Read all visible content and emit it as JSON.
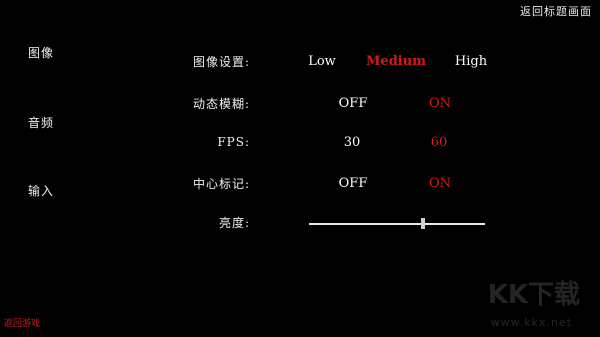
{
  "header": {
    "return_title_label": "返回标题画面"
  },
  "sidebar": {
    "items": [
      {
        "label": "图像"
      },
      {
        "label": "音频"
      },
      {
        "label": "输入"
      }
    ]
  },
  "settings": {
    "image_quality": {
      "label": "图像设置:",
      "options": [
        "Low",
        "Medium",
        "High"
      ],
      "selected": "Medium"
    },
    "motion_blur": {
      "label": "动态模糊:",
      "options": [
        "OFF",
        "ON"
      ],
      "selected": "ON"
    },
    "fps": {
      "label": "FPS:",
      "options": [
        "30",
        "60"
      ],
      "selected": "60"
    },
    "center_marker": {
      "label": "中心标记:",
      "options": [
        "OFF",
        "ON"
      ],
      "selected": "ON"
    },
    "brightness": {
      "label": "亮度:",
      "value": 0.65
    }
  },
  "footer": {
    "return_game_label": "返回游戏"
  },
  "watermark": {
    "text": "KK下载",
    "url": "www.kkx.net"
  },
  "colors": {
    "background": "#000000",
    "text": "#ffffff",
    "accent": "#d41a1a"
  }
}
